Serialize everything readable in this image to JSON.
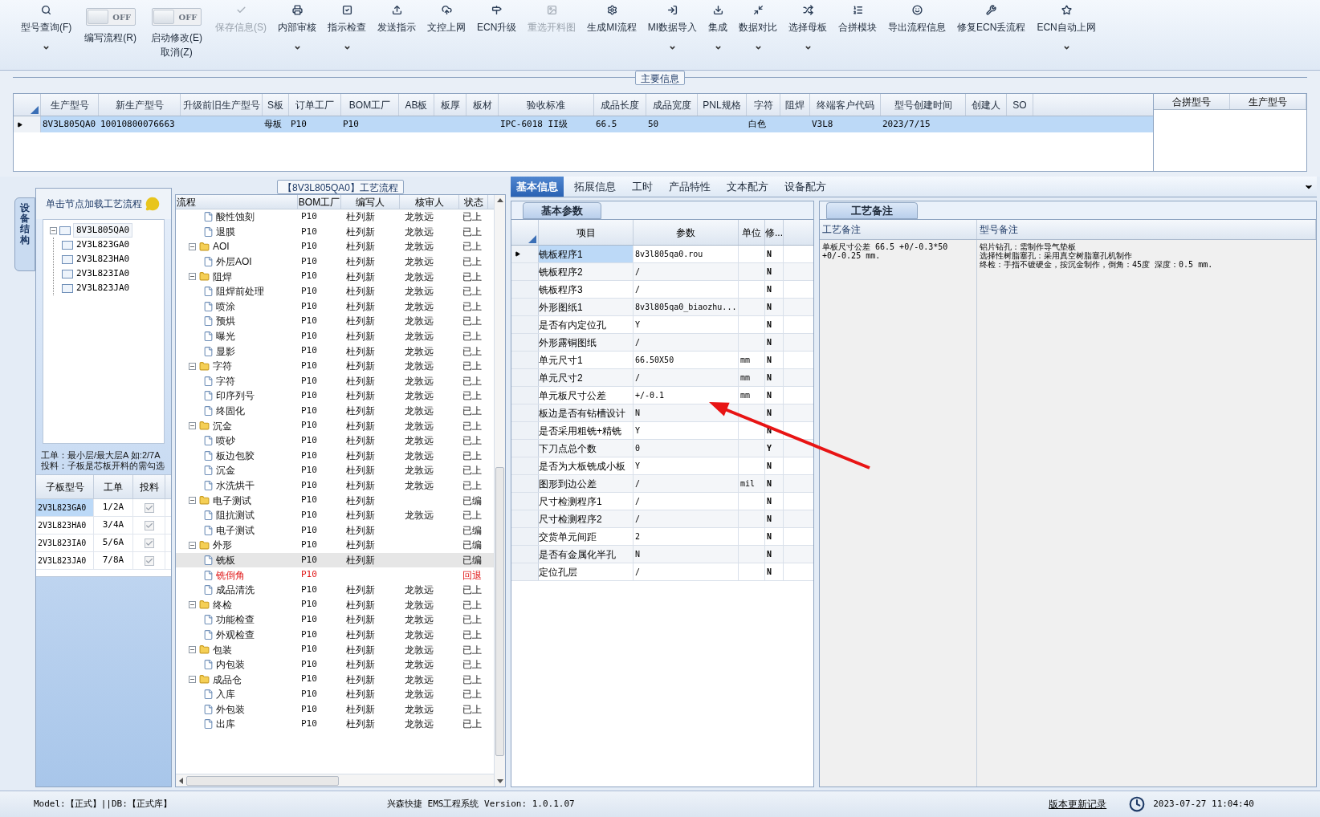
{
  "toolbar": [
    {
      "kind": "button",
      "label": "型号查询(F)",
      "dropdown": true,
      "disabled": false
    },
    {
      "kind": "toggle",
      "label": "编写流程(R)",
      "state_text": "OFF",
      "on": false
    },
    {
      "kind": "toggle",
      "label": "启动修改(E)",
      "sublabel": "取消(Z)",
      "state_text": "OFF",
      "on": false
    },
    {
      "kind": "button",
      "label": "保存信息(S)",
      "dropdown": false,
      "disabled": true
    },
    {
      "kind": "button",
      "label": "内部审核",
      "dropdown": true,
      "disabled": false
    },
    {
      "kind": "button",
      "label": "指示检查",
      "dropdown": true,
      "disabled": false
    },
    {
      "kind": "button",
      "label": "发送指示",
      "dropdown": false,
      "disabled": false
    },
    {
      "kind": "button",
      "label": "文控上网",
      "dropdown": false,
      "disabled": false
    },
    {
      "kind": "button",
      "label": "ECN升级",
      "dropdown": false,
      "disabled": false
    },
    {
      "kind": "button",
      "label": "重选开料图",
      "dropdown": false,
      "disabled": true
    },
    {
      "kind": "button",
      "label": "生成MI流程",
      "dropdown": false,
      "disabled": false
    },
    {
      "kind": "button",
      "label": "MI数据导入",
      "dropdown": true,
      "disabled": false
    },
    {
      "kind": "button",
      "label": "集成",
      "dropdown": true,
      "disabled": false
    },
    {
      "kind": "button",
      "label": "数据对比",
      "dropdown": true,
      "disabled": false
    },
    {
      "kind": "button",
      "label": "选择母板",
      "dropdown": true,
      "disabled": false
    },
    {
      "kind": "button",
      "label": "合拼模块",
      "dropdown": false,
      "disabled": false
    },
    {
      "kind": "button",
      "label": "导出流程信息",
      "dropdown": false,
      "disabled": false
    },
    {
      "kind": "button",
      "label": "修复ECN丢流程",
      "dropdown": false,
      "disabled": false
    },
    {
      "kind": "button",
      "label": "ECN自动上网",
      "dropdown": true,
      "disabled": false
    }
  ],
  "main_info": {
    "title": "主要信息",
    "columns": [
      "生产型号",
      "新生产型号",
      "升级前旧生产型号",
      "S板",
      "订单工厂",
      "BOM工厂",
      "AB板",
      "板厚",
      "板材",
      "验收标准",
      "成品长度",
      "成品宽度",
      "PNL规格",
      "字符",
      "阻焊",
      "终端客户代码",
      "型号创建时间",
      "创建人",
      "SO"
    ],
    "rows": [
      {
        "selected": true,
        "cells": [
          "8V3L805QA0",
          "10010800076663",
          null,
          "母板",
          "P10",
          "P10",
          null,
          null,
          null,
          "IPC-6018 II级",
          "66.5",
          "50",
          null,
          "白色",
          null,
          "V3L8",
          "2023/7/15",
          null,
          null
        ]
      }
    ],
    "side_columns": [
      "合拼型号",
      "生产型号"
    ]
  },
  "left_panel": {
    "vertical_tab": {
      "label": "设备结构",
      "selected": true
    },
    "header": "单击节点加载工艺流程",
    "tree": [
      {
        "label": "8V3L805QA0",
        "expanded": true,
        "children": [
          {
            "label": "2V3L823GA0"
          },
          {
            "label": "2V3L823HA0"
          },
          {
            "label": "2V3L823IA0"
          },
          {
            "label": "2V3L823JA0"
          }
        ]
      }
    ],
    "notes": [
      "工单：最小层/最大层A 如:2/7A",
      "投料：子板是芯板开料的需勾选"
    ],
    "sub_table": {
      "columns": [
        "子板型号",
        "工单",
        "投料"
      ],
      "rows": [
        {
          "model": "2V3L823GA0",
          "order": "1/2A",
          "checked": true,
          "selected": true
        },
        {
          "model": "2V3L823HA0",
          "order": "3/4A",
          "checked": true,
          "selected": false
        },
        {
          "model": "2V3L823IA0",
          "order": "5/6A",
          "checked": true,
          "selected": false
        },
        {
          "model": "2V3L823JA0",
          "order": "7/8A",
          "checked": true,
          "selected": false
        }
      ]
    }
  },
  "flow": {
    "title": "【8V3L805QA0】工艺流程",
    "columns": [
      "流程",
      "BOM工厂",
      "编写人",
      "核审人",
      "状态"
    ],
    "rows": [
      {
        "kind": "step",
        "name": "酸性蚀刻",
        "bom": "P10",
        "writer": "杜列新",
        "reviewer": "龙敦远",
        "status": "已上",
        "selected": false,
        "flagged": false
      },
      {
        "kind": "step",
        "name": "退膜",
        "bom": "P10",
        "writer": "杜列新",
        "reviewer": "龙敦远",
        "status": "已上",
        "selected": false,
        "flagged": false
      },
      {
        "kind": "group",
        "name": "AOI",
        "bom": "P10",
        "writer": "杜列新",
        "reviewer": "龙敦远",
        "status": "已上",
        "expanded": true,
        "children": [
          {
            "kind": "step",
            "name": "外层AOI",
            "bom": "P10",
            "writer": "杜列新",
            "reviewer": "龙敦远",
            "status": "已上",
            "selected": false,
            "flagged": false
          }
        ]
      },
      {
        "kind": "group",
        "name": "阻焊",
        "bom": "P10",
        "writer": "杜列新",
        "reviewer": "龙敦远",
        "status": "已上",
        "expanded": true,
        "children": [
          {
            "kind": "step",
            "name": "阻焊前处理",
            "bom": "P10",
            "writer": "杜列新",
            "reviewer": "龙敦远",
            "status": "已上",
            "selected": false,
            "flagged": false
          },
          {
            "kind": "step",
            "name": "喷涂",
            "bom": "P10",
            "writer": "杜列新",
            "reviewer": "龙敦远",
            "status": "已上",
            "selected": false,
            "flagged": false
          },
          {
            "kind": "step",
            "name": "预烘",
            "bom": "P10",
            "writer": "杜列新",
            "reviewer": "龙敦远",
            "status": "已上",
            "selected": false,
            "flagged": false
          },
          {
            "kind": "step",
            "name": "曝光",
            "bom": "P10",
            "writer": "杜列新",
            "reviewer": "龙敦远",
            "status": "已上",
            "selected": false,
            "flagged": false
          },
          {
            "kind": "step",
            "name": "显影",
            "bom": "P10",
            "writer": "杜列新",
            "reviewer": "龙敦远",
            "status": "已上",
            "selected": false,
            "flagged": false
          }
        ]
      },
      {
        "kind": "group",
        "name": "字符",
        "bom": "P10",
        "writer": "杜列新",
        "reviewer": "龙敦远",
        "status": "已上",
        "expanded": true,
        "children": [
          {
            "kind": "step",
            "name": "字符",
            "bom": "P10",
            "writer": "杜列新",
            "reviewer": "龙敦远",
            "status": "已上",
            "selected": false,
            "flagged": false
          },
          {
            "kind": "step",
            "name": "印序列号",
            "bom": "P10",
            "writer": "杜列新",
            "reviewer": "龙敦远",
            "status": "已上",
            "selected": false,
            "flagged": false
          },
          {
            "kind": "step",
            "name": "终固化",
            "bom": "P10",
            "writer": "杜列新",
            "reviewer": "龙敦远",
            "status": "已上",
            "selected": false,
            "flagged": false
          }
        ]
      },
      {
        "kind": "group",
        "name": "沉金",
        "bom": "P10",
        "writer": "杜列新",
        "reviewer": "龙敦远",
        "status": "已上",
        "expanded": true,
        "children": [
          {
            "kind": "step",
            "name": "喷砂",
            "bom": "P10",
            "writer": "杜列新",
            "reviewer": "龙敦远",
            "status": "已上",
            "selected": false,
            "flagged": false
          },
          {
            "kind": "step",
            "name": "板边包胶",
            "bom": "P10",
            "writer": "杜列新",
            "reviewer": "龙敦远",
            "status": "已上",
            "selected": false,
            "flagged": false
          },
          {
            "kind": "step",
            "name": "沉金",
            "bom": "P10",
            "writer": "杜列新",
            "reviewer": "龙敦远",
            "status": "已上",
            "selected": false,
            "flagged": false
          },
          {
            "kind": "step",
            "name": "水洗烘干",
            "bom": "P10",
            "writer": "杜列新",
            "reviewer": "龙敦远",
            "status": "已上",
            "selected": false,
            "flagged": false
          }
        ]
      },
      {
        "kind": "group",
        "name": "电子测试",
        "bom": "P10",
        "writer": "杜列新",
        "status": "已编",
        "expanded": true,
        "children": [
          {
            "kind": "step",
            "name": "阻抗测试",
            "bom": "P10",
            "writer": "杜列新",
            "reviewer": "龙敦远",
            "status": "已上",
            "selected": false,
            "flagged": false
          },
          {
            "kind": "step",
            "name": "电子测试",
            "bom": "P10",
            "writer": "杜列新",
            "status": "已编",
            "selected": false,
            "flagged": false
          }
        ]
      },
      {
        "kind": "group",
        "name": "外形",
        "bom": "P10",
        "writer": "杜列新",
        "status": "已编",
        "expanded": true,
        "children": [
          {
            "kind": "step",
            "name": "铣板",
            "bom": "P10",
            "writer": "杜列新",
            "status": "已编",
            "selected": true,
            "flagged": false
          },
          {
            "kind": "step",
            "name": "铣倒角",
            "bom": "P10",
            "status": "回退",
            "selected": false,
            "flagged": true
          },
          {
            "kind": "step",
            "name": "成品清洗",
            "bom": "P10",
            "writer": "杜列新",
            "reviewer": "龙敦远",
            "status": "已上",
            "selected": false,
            "flagged": false
          }
        ]
      },
      {
        "kind": "group",
        "name": "终检",
        "bom": "P10",
        "writer": "杜列新",
        "reviewer": "龙敦远",
        "status": "已上",
        "expanded": true,
        "children": [
          {
            "kind": "step",
            "name": "功能检查",
            "bom": "P10",
            "writer": "杜列新",
            "reviewer": "龙敦远",
            "status": "已上",
            "selected": false,
            "flagged": false
          },
          {
            "kind": "step",
            "name": "外观检查",
            "bom": "P10",
            "writer": "杜列新",
            "reviewer": "龙敦远",
            "status": "已上",
            "selected": false,
            "flagged": false
          }
        ]
      },
      {
        "kind": "group",
        "name": "包装",
        "bom": "P10",
        "writer": "杜列新",
        "reviewer": "龙敦远",
        "status": "已上",
        "expanded": true,
        "children": [
          {
            "kind": "step",
            "name": "内包装",
            "bom": "P10",
            "writer": "杜列新",
            "reviewer": "龙敦远",
            "status": "已上",
            "selected": false,
            "flagged": false
          }
        ]
      },
      {
        "kind": "group",
        "name": "成品仓",
        "bom": "P10",
        "writer": "杜列新",
        "reviewer": "龙敦远",
        "status": "已上",
        "expanded": true,
        "children": [
          {
            "kind": "step",
            "name": "入库",
            "bom": "P10",
            "writer": "杜列新",
            "reviewer": "龙敦远",
            "status": "已上",
            "selected": false,
            "flagged": false
          },
          {
            "kind": "step",
            "name": "外包装",
            "bom": "P10",
            "writer": "杜列新",
            "reviewer": "龙敦远",
            "status": "已上",
            "selected": false,
            "flagged": false
          },
          {
            "kind": "step",
            "name": "出库",
            "bom": "P10",
            "writer": "杜列新",
            "reviewer": "龙敦远",
            "status": "已上",
            "selected": false,
            "flagged": false
          }
        ]
      }
    ]
  },
  "params": {
    "tabs": [
      {
        "label": "基本信息",
        "selected": true
      },
      {
        "label": "拓展信息",
        "selected": false
      },
      {
        "label": "工时",
        "selected": false
      },
      {
        "label": "产品特性",
        "selected": false
      },
      {
        "label": "文本配方",
        "selected": false
      },
      {
        "label": "设备配方",
        "selected": false
      }
    ],
    "sub_tab": "基本参数",
    "columns": [
      "项目",
      "参数",
      "单位",
      "修..."
    ],
    "rows": [
      {
        "item": "铣板程序1",
        "value": "8v3l805qa0.rou",
        "unit": null,
        "flag": "N",
        "selected": true
      },
      {
        "item": "铣板程序2",
        "value": "/",
        "unit": null,
        "flag": "N",
        "selected": false
      },
      {
        "item": "铣板程序3",
        "value": "/",
        "unit": null,
        "flag": "N",
        "selected": false
      },
      {
        "item": "外形图纸1",
        "value": "8v3l805qa0_biaozhu...",
        "unit": null,
        "flag": "N",
        "selected": false
      },
      {
        "item": "是否有内定位孔",
        "value": "Y",
        "unit": null,
        "flag": "N",
        "selected": false
      },
      {
        "item": "外形露铜图纸",
        "value": "/",
        "unit": null,
        "flag": "N",
        "selected": false
      },
      {
        "item": "单元尺寸1",
        "value": "66.50X50",
        "unit": "mm",
        "flag": "N",
        "selected": false
      },
      {
        "item": "单元尺寸2",
        "value": "/",
        "unit": "mm",
        "flag": "N",
        "selected": false
      },
      {
        "item": "单元板尺寸公差",
        "value": "+/-0.1",
        "unit": "mm",
        "flag": "N",
        "selected": false
      },
      {
        "item": "板边是否有钻槽设计",
        "value": "N",
        "unit": null,
        "flag": "N",
        "selected": false
      },
      {
        "item": "是否采用粗铣+精铣",
        "value": "Y",
        "unit": null,
        "flag": "N",
        "selected": false
      },
      {
        "item": "下刀点总个数",
        "value": "0",
        "unit": null,
        "flag": "Y",
        "selected": false
      },
      {
        "item": "是否为大板铣成小板",
        "value": "Y",
        "unit": null,
        "flag": "N",
        "selected": false
      },
      {
        "item": "图形到边公差",
        "value": "/",
        "unit": "mil",
        "flag": "N",
        "selected": false
      },
      {
        "item": "尺寸检测程序1",
        "value": "/",
        "unit": null,
        "flag": "N",
        "selected": false
      },
      {
        "item": "尺寸检测程序2",
        "value": "/",
        "unit": null,
        "flag": "N",
        "selected": false
      },
      {
        "item": "交货单元间距",
        "value": "2",
        "unit": null,
        "flag": "N",
        "selected": false
      },
      {
        "item": "是否有金属化半孔",
        "value": "N",
        "unit": null,
        "flag": "N",
        "selected": false
      },
      {
        "item": "定位孔层",
        "value": "/",
        "unit": null,
        "flag": "N",
        "selected": false
      }
    ]
  },
  "remarks": {
    "sub_tab": "工艺备注",
    "columns": [
      "工艺备注",
      "型号备注"
    ],
    "process_note": "单板尺寸公差 66.5 +0/-0.3*50 +0/-0.25 mm.",
    "model_note": [
      "铝片钻孔：需制作导气垫板",
      "选择性树脂塞孔：采用真空树脂塞孔机制作",
      "终检：手指不镀硬金，按沉金制作，倒角：45度 深度：0.5 mm."
    ]
  },
  "status_bar": {
    "model": "Model:【正式】||DB:【正式库】",
    "product": "兴森快捷 EMS工程系统 Version: 1.0.1.07",
    "link": "版本更新记录",
    "datetime": "2023-07-27 11:04:40"
  }
}
